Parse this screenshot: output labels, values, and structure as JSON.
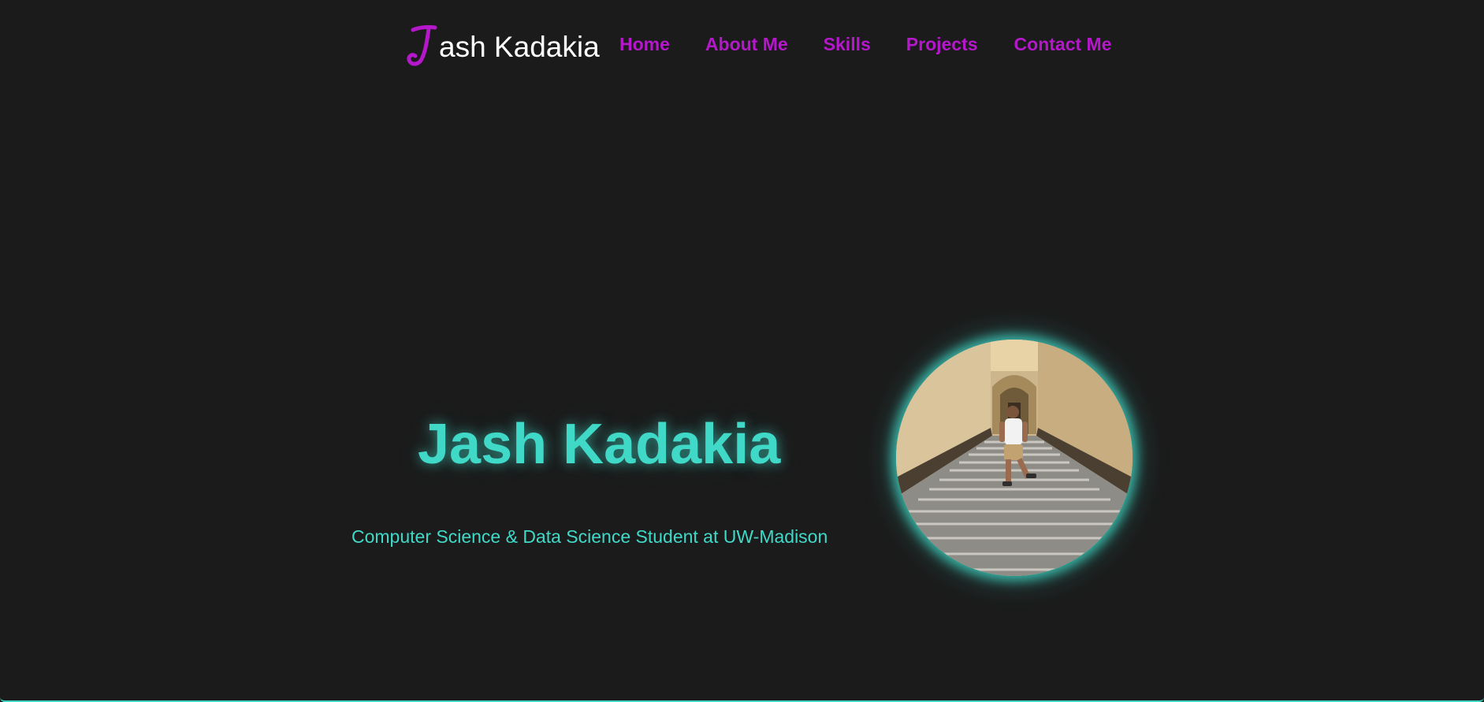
{
  "header": {
    "logo": {
      "mark_letter": "J",
      "text": "ash Kadakia"
    },
    "nav": [
      {
        "label": "Home"
      },
      {
        "label": "About Me"
      },
      {
        "label": "Skills"
      },
      {
        "label": "Projects"
      },
      {
        "label": "Contact Me"
      }
    ]
  },
  "hero": {
    "title": "Jash Kadakia",
    "subtitle": "Computer Science & Data Science Student at UW-Madison",
    "photo_icon": "profile-photo"
  },
  "colors": {
    "background": "#1b1b1b",
    "accent_purple": "#b517cb",
    "accent_teal": "#40d9c8",
    "logo_text": "#ffffff"
  }
}
